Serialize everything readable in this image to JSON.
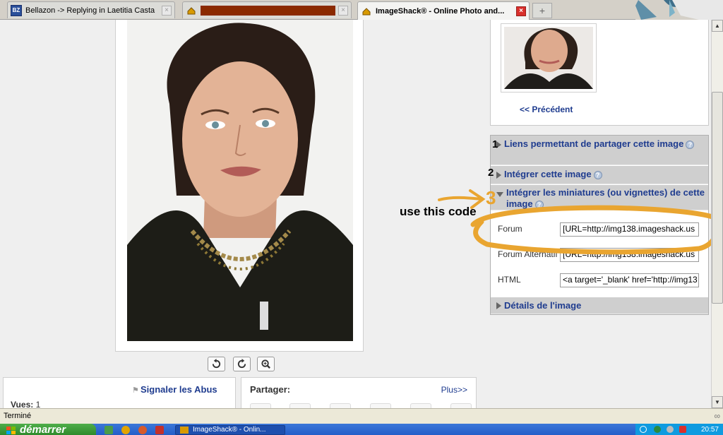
{
  "tabs": [
    {
      "title": "Bellazon -> Replying in Laetitia Casta",
      "favicon": "bz-icon",
      "active": false
    },
    {
      "title": "",
      "favicon": "imageshack-icon",
      "active": false,
      "redacted": true
    },
    {
      "title": "ImageShack® - Online Photo and...",
      "favicon": "imageshack-icon",
      "active": true
    }
  ],
  "new_tab_label": "+",
  "thumb_panel": {
    "prev_link": "<< Précédent"
  },
  "share_panel": {
    "section1": "Liens permettant de partager cette image",
    "section2": "Intégrer cette image",
    "section3": "Intégrer les miniatures (ou vignettes) de cette image",
    "section4": "Détails de l'image",
    "help": "?",
    "fields": [
      {
        "label": "Forum",
        "value": "[URL=http://img138.imageshack.us"
      },
      {
        "label": "Forum Alternatif",
        "value": "[URL=http://img138.imageshack.us"
      },
      {
        "label": "HTML",
        "value": "<a target='_blank' href='http://img13"
      }
    ]
  },
  "annotations": {
    "step1": "1",
    "step2": "2",
    "step3": "3",
    "use_code": "use this code",
    "highlight_color": "#e9a530"
  },
  "stats": {
    "report_link": "Signaler les Abus",
    "views_label": "Vues:",
    "views_value": "1"
  },
  "share_box": {
    "title": "Partager:",
    "more": "Plus>>"
  },
  "status": {
    "text": "Terminé"
  },
  "taskbar": {
    "start_label": "démarrer",
    "task_label": "ImageShack® - Onlin...",
    "clock": "20:57"
  },
  "colors": {
    "link": "#1f3c8f",
    "accordion_bg": "#cfcfcf",
    "annotation": "#e9a530"
  }
}
